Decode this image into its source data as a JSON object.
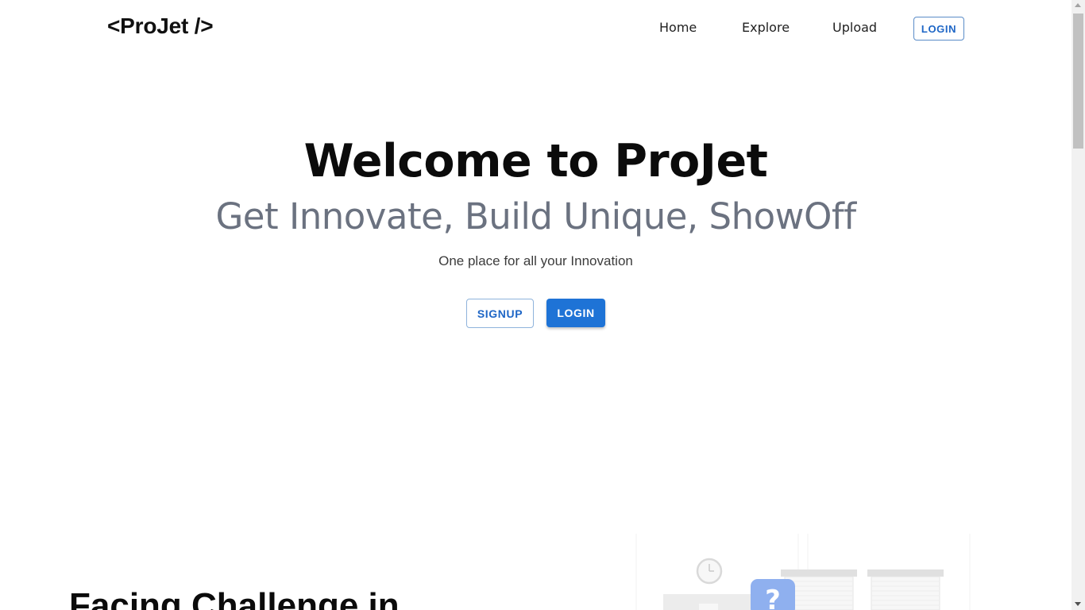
{
  "navbar": {
    "logo": "<ProJet />",
    "links": [
      "Home",
      "Explore",
      "Upload"
    ],
    "login_label": "LOGIN"
  },
  "hero": {
    "title": "Welcome to ProJet",
    "subtitle": "Get Innovate, Build Unique, ShowOff",
    "tagline": "One place for all your Innovation",
    "signup_label": "SIGNUP",
    "login_label": "LOGIN"
  },
  "section": {
    "heading": "Facing Challenge in",
    "illustration_icon": "question-mark-icon",
    "illustration_text": "?"
  },
  "colors": {
    "primary": "#1e73d6",
    "subtitle_gray": "#6b7280",
    "question_badge": "#8fb0ef"
  }
}
